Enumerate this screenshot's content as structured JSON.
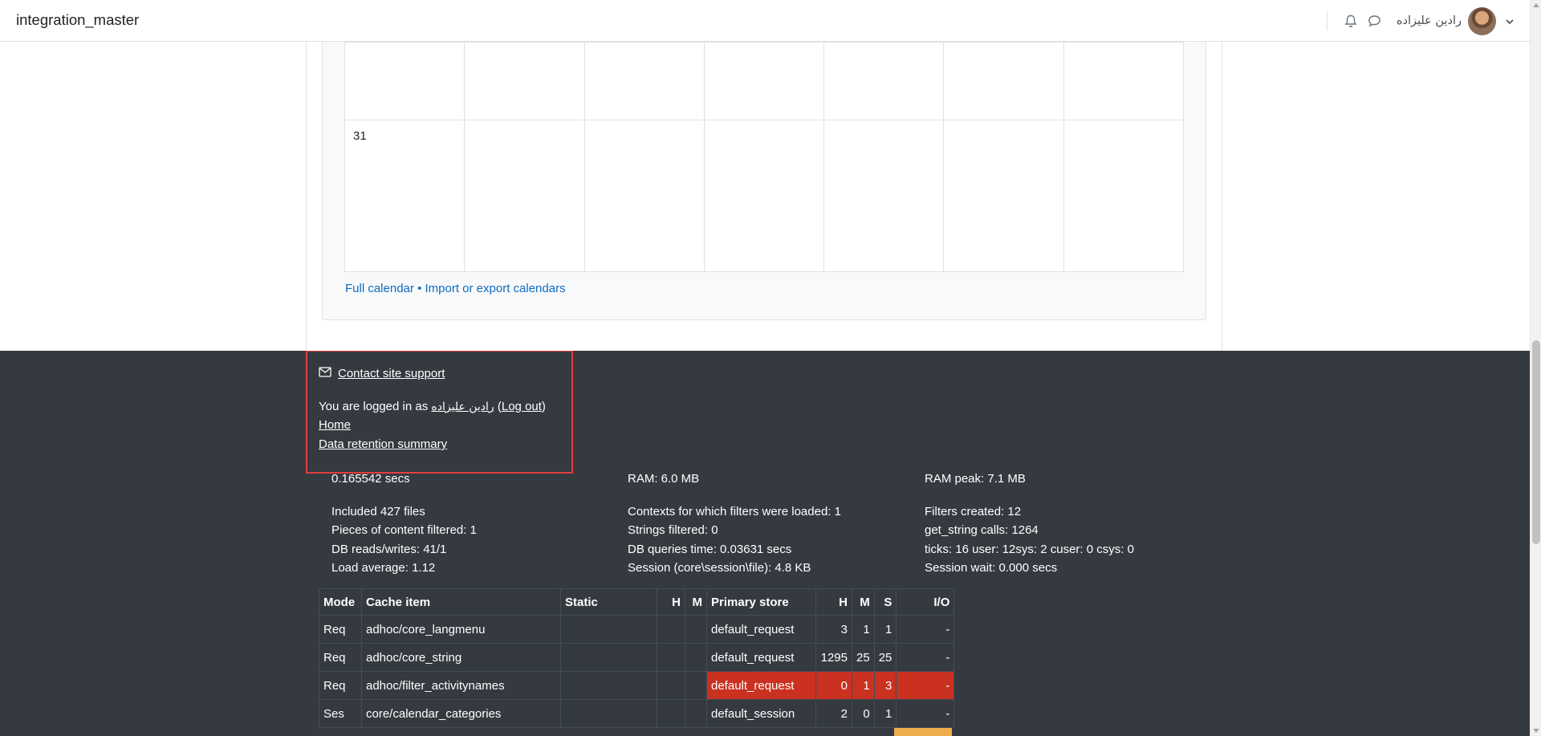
{
  "navbar": {
    "brand": "integration_master",
    "user_name": "رادین علیزاده",
    "icons": [
      "bell-icon",
      "chat-icon",
      "chevron-down-icon"
    ]
  },
  "calendar": {
    "rows": [
      {
        "day": ""
      },
      {
        "day": "31"
      }
    ],
    "links": {
      "full": "Full calendar",
      "separator": "•",
      "import_export": "Import or export calendars"
    }
  },
  "footer": {
    "contact_support": "Contact site support",
    "logged_in_prefix": "You are logged in as",
    "user_name": "رادین علیزاده",
    "open_paren": " (",
    "logout": "Log out",
    "close_paren": ")",
    "home": "Home",
    "data_retention": "Data retention summary"
  },
  "performance": {
    "col1": [
      "0.165542 secs",
      "",
      "Included 427 files",
      "Pieces of content filtered: 1",
      "DB reads/writes: 41/1",
      "Load average: 1.12"
    ],
    "col2": [
      "RAM: 6.0 MB",
      "",
      "Contexts for which filters were loaded: 1",
      "Strings filtered: 0",
      "DB queries time: 0.03631 secs",
      "Session (core\\session\\file): 4.8 KB"
    ],
    "col3": [
      "RAM peak: 7.1 MB",
      "",
      "Filters created: 12",
      "get_string calls: 1264",
      "ticks: 16 user: 12sys: 2 cuser: 0 csys: 0",
      "Session wait: 0.000 secs"
    ]
  },
  "cache_table": {
    "headers": [
      "Mode",
      "Cache item",
      "Static",
      "H",
      "M",
      "Primary store",
      "H",
      "M",
      "S",
      "I/O"
    ],
    "rows": [
      [
        "Req",
        "adhoc/core_langmenu",
        "",
        "",
        "",
        "default_request",
        "3",
        "1",
        "1",
        "-"
      ],
      [
        "Req",
        "adhoc/core_string",
        "",
        "",
        "",
        "default_request",
        "1295",
        "25",
        "25",
        "-"
      ],
      [
        "Req",
        "adhoc/filter_activitynames",
        "",
        "",
        "",
        "default_request",
        "0",
        "1",
        "3",
        "-"
      ],
      [
        "Ses",
        "core/calendar_categories",
        "",
        "",
        "",
        "default_session",
        "2",
        "0",
        "1",
        "-"
      ]
    ]
  },
  "colors": {
    "footer_bg": "#343a40",
    "link": "#0f6cbf",
    "highlight_red": "#ca3120",
    "highlight_orange": "#f0ad4e",
    "annotation_border": "#e33d3d"
  }
}
